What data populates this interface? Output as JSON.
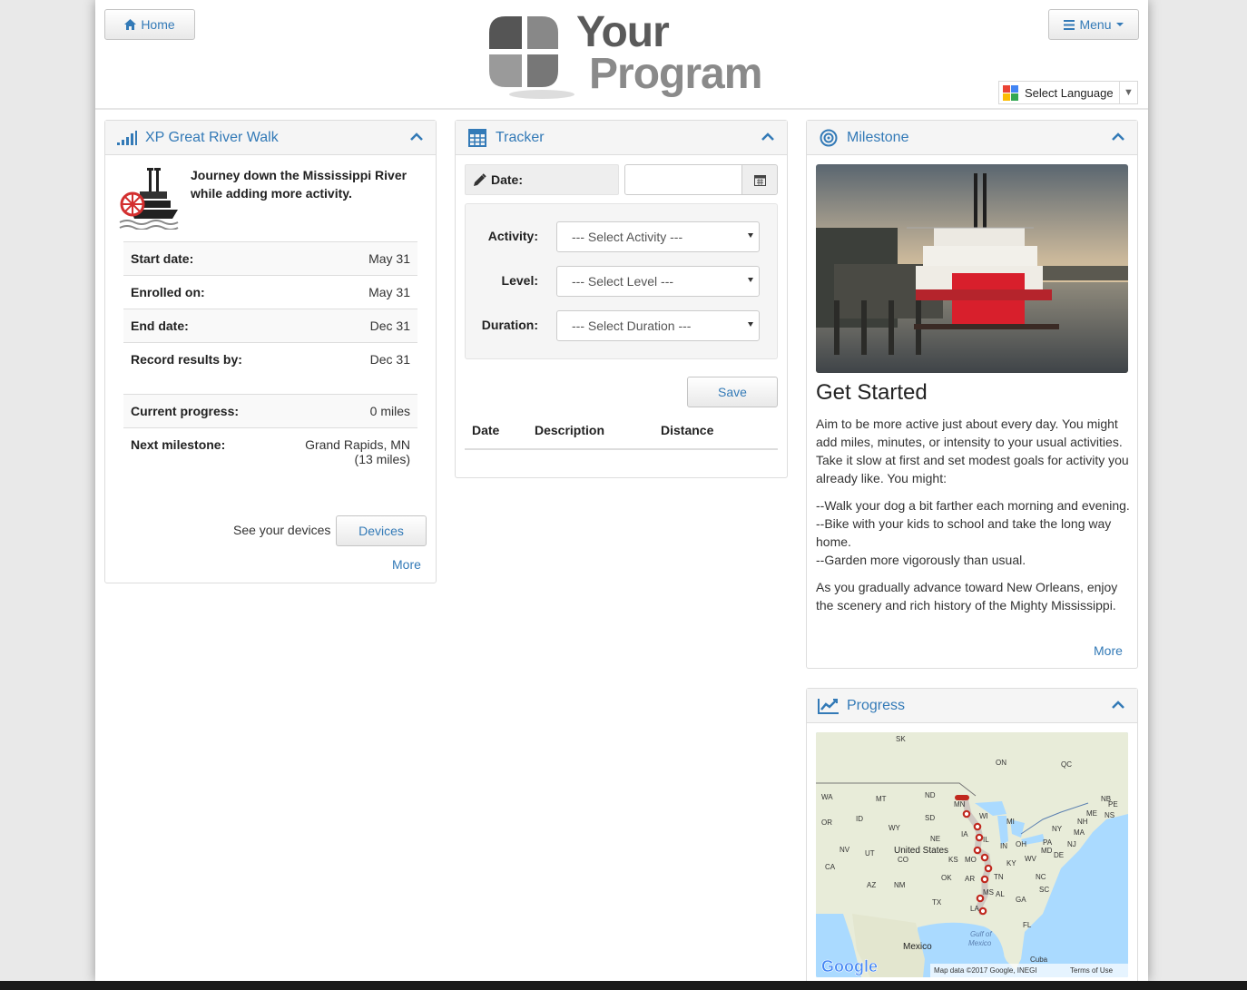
{
  "header": {
    "home_label": "Home",
    "menu_label": "Menu",
    "logo_line1": "Your",
    "logo_line2": "Program",
    "language_label": "Select Language"
  },
  "left_panel": {
    "title": "XP Great River Walk",
    "intro": "Journey down the Mississippi River while adding more activity.",
    "rows": [
      {
        "label": "Start date:",
        "value": "May 31"
      },
      {
        "label": "Enrolled on:",
        "value": "May 31"
      },
      {
        "label": "End date:",
        "value": "Dec 31"
      },
      {
        "label": "Record results by:",
        "value": "Dec 31"
      },
      {
        "label": "Current progress:",
        "value": "0 miles"
      },
      {
        "label": "Next milestone:",
        "value": "Grand Rapids, MN",
        "value2": "(13 miles)"
      }
    ],
    "devices_text": "See your devices",
    "devices_button": "Devices",
    "more": "More"
  },
  "tracker": {
    "title": "Tracker",
    "date_label": "Date:",
    "date_value": "",
    "activity_label": "Activity:",
    "activity_value": "--- Select Activity ---",
    "level_label": "Level:",
    "level_value": "--- Select Level ---",
    "duration_label": "Duration:",
    "duration_value": "--- Select Duration ---",
    "save_label": "Save",
    "columns": [
      "Date",
      "Description",
      "Distance"
    ]
  },
  "milestone": {
    "title": "Milestone",
    "heading": "Get Started",
    "para1": "Aim to be more active just about every day. You might add miles, minutes, or intensity to your usual activities. Take it slow at first and set modest goals for activity you already like. You might:",
    "tips": [
      "--Walk your dog a bit farther each morning and evening.",
      "--Bike with your kids to school and take the long way home.",
      "--Garden more vigorously than usual."
    ],
    "para2": "As you gradually advance toward New Orleans, enjoy the scenery and rich history of the Mighty Mississippi.",
    "more": "More"
  },
  "progress": {
    "title": "Progress",
    "map": {
      "labels": [
        "SK",
        "ON",
        "QC",
        "WA",
        "MT",
        "ND",
        "MN",
        "NB",
        "PE",
        "OR",
        "ID",
        "SD",
        "WI",
        "MI",
        "ME",
        "NS",
        "NY",
        "NH",
        "MA",
        "WY",
        "NE",
        "IA",
        "IL",
        "IN",
        "OH",
        "PA",
        "MD",
        "DE",
        "NJ",
        "NV",
        "UT",
        "United States",
        "CO",
        "KS",
        "MO",
        "KY",
        "WV",
        "CA",
        "OK",
        "AR",
        "TN",
        "NC",
        "AZ",
        "NM",
        "TX",
        "MS",
        "AL",
        "GA",
        "SC",
        "LA",
        "FL",
        "Gulf of",
        "Mexico",
        "Mexico",
        "Cuba"
      ],
      "attribution": "Map data ©2017 Google, INEGI",
      "terms": "Terms of Use",
      "brand": "Google"
    }
  },
  "colors": {
    "link": "#337ab7",
    "route": "#c0281e",
    "map_water": "#aadaff",
    "map_land": "#e8ecd9"
  }
}
